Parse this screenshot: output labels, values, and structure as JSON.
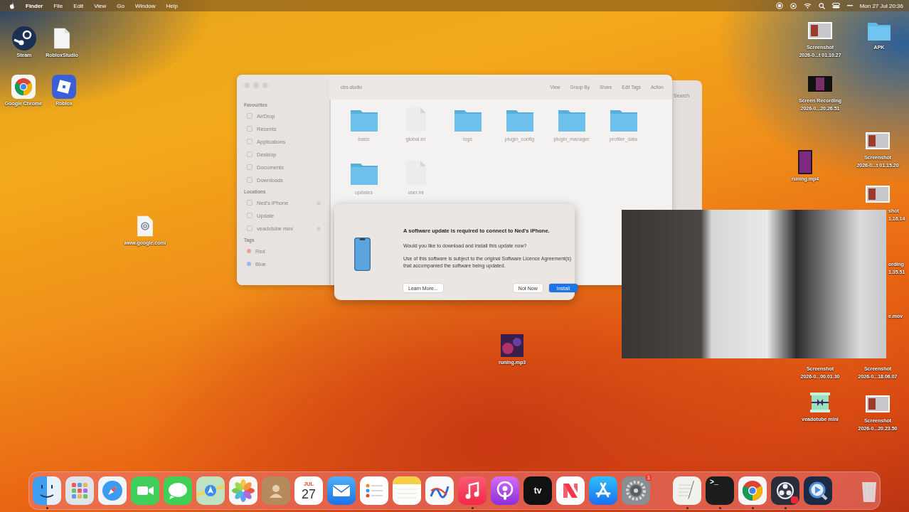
{
  "menu_bar": {
    "app": "Finder",
    "menus": [
      "File",
      "Edit",
      "View",
      "Go",
      "Window",
      "Help"
    ],
    "clock": "Mon 27 Jul  20:36"
  },
  "desktop_icons": [
    {
      "kind": "steam",
      "lines": [
        "Steam"
      ]
    },
    {
      "kind": "document",
      "lines": [
        "RobloxStudio"
      ]
    },
    {
      "kind": "chrome",
      "lines": [
        "Google Chrome"
      ]
    },
    {
      "kind": "roblox",
      "lines": [
        "Roblox"
      ]
    },
    {
      "kind": "webloc",
      "lines": [
        "www.google.com/"
      ]
    },
    {
      "kind": "audio",
      "lines": [
        "runing.mp3"
      ]
    },
    {
      "kind": "thumbnail",
      "lines": [
        "Screenshot",
        "2026-0...t 01.10.27"
      ]
    },
    {
      "kind": "folder",
      "lines": [
        "APK"
      ]
    },
    {
      "kind": "recording",
      "lines": [
        "Screen Recording",
        "2026-0...20.26.51"
      ]
    },
    {
      "kind": "thumbnail",
      "lines": [
        "Screenshot",
        "2026-0...t 01.15.20"
      ]
    },
    {
      "kind": "video",
      "lines": [
        "runing.mp4"
      ]
    },
    {
      "kind": "thumbnail"
    },
    {
      "kind": "partial",
      "lines": [
        "shot",
        "1.16.14"
      ]
    },
    {
      "kind": "partial",
      "lines": [
        "ording",
        "1.35.51"
      ]
    },
    {
      "kind": "partial",
      "lines": [
        "e.mov"
      ]
    },
    {
      "kind": "hidden",
      "lines": [
        "Screenshot",
        "2026-0...00.01.30"
      ]
    },
    {
      "kind": "hidden",
      "lines": [
        "Screenshot",
        "2026-0...18.06.07"
      ]
    },
    {
      "kind": "giftbox",
      "lines": [
        "veadotube mini"
      ]
    },
    {
      "kind": "thumbnail",
      "lines": [
        "Screenshot",
        "2026-0...20.23.50"
      ]
    }
  ],
  "finder": {
    "title": "obs-studio",
    "toolbar": [
      "View",
      "Group By",
      "Share",
      "Edit Tags",
      "Action"
    ],
    "search": "Search",
    "sidebar": [
      {
        "heading": "Favourites",
        "items": [
          {
            "label": "AirDrop"
          },
          {
            "label": "Recents"
          },
          {
            "label": "Applications"
          },
          {
            "label": "Desktop"
          },
          {
            "label": "Documents"
          },
          {
            "label": "Downloads"
          }
        ]
      },
      {
        "heading": "Locations",
        "items": [
          {
            "label": "Ned's iPhone",
            "ejectable": true
          },
          {
            "label": "Update",
            "ejectable": false
          },
          {
            "label": "veadotube mini",
            "ejectable": true
          }
        ]
      },
      {
        "heading": "Tags",
        "items": [
          {
            "label": "Red",
            "color": "#f0a09a"
          },
          {
            "label": "Blue",
            "color": "#9ab8e8"
          }
        ]
      }
    ],
    "files": [
      {
        "name": "basic",
        "kind": "folder"
      },
      {
        "name": "global.ini",
        "kind": "file"
      },
      {
        "name": "logs",
        "kind": "folder"
      },
      {
        "name": "plugin_config",
        "kind": "folder"
      },
      {
        "name": "plugin_manager",
        "kind": "folder"
      },
      {
        "name": "profiler_data",
        "kind": "folder"
      },
      {
        "name": "updates",
        "kind": "folder"
      },
      {
        "name": "user.ini",
        "kind": "file"
      }
    ]
  },
  "dialog": {
    "title": "A software update is required to connect to Ned's iPhone.",
    "message": "Would you like to download and install this update now?",
    "note": "Use of this software is subject to the original Software Licence Agreement(s) that accompanied the software being updated.",
    "buttons": [
      {
        "label": "Learn More...",
        "kind": "help"
      },
      {
        "label": "Not Now",
        "kind": "normal"
      },
      {
        "label": "Install",
        "kind": "default"
      }
    ]
  },
  "dock": {
    "items": [
      {
        "kind": "finder",
        "running": true
      },
      {
        "kind": "launchpad",
        "running": false
      },
      {
        "kind": "safari",
        "running": false
      },
      {
        "kind": "facetime",
        "running": false
      },
      {
        "kind": "messages",
        "running": false
      },
      {
        "kind": "maps",
        "running": false
      },
      {
        "kind": "photos",
        "running": false
      },
      {
        "kind": "contacts",
        "running": false
      },
      {
        "kind": "calendar",
        "running": false,
        "month": "JUL",
        "day": "27"
      },
      {
        "kind": "mail",
        "running": false
      },
      {
        "kind": "reminders",
        "running": false
      },
      {
        "kind": "notes",
        "running": false
      },
      {
        "kind": "freeform",
        "running": false
      },
      {
        "kind": "music",
        "running": true
      },
      {
        "kind": "podcasts",
        "running": false
      },
      {
        "kind": "tv",
        "running": false,
        "text": "tv"
      },
      {
        "kind": "news",
        "running": false
      },
      {
        "kind": "appstore",
        "running": false
      },
      {
        "kind": "settings",
        "running": false,
        "badge": "1"
      },
      {
        "kind": "separator"
      },
      {
        "kind": "textedit",
        "running": true
      },
      {
        "kind": "terminal",
        "running": true,
        "text": ">_"
      },
      {
        "kind": "chrome",
        "running": true
      },
      {
        "kind": "obs",
        "running": true
      },
      {
        "kind": "quicktime",
        "running": false
      },
      {
        "kind": "separator"
      },
      {
        "kind": "trash",
        "running": false
      }
    ]
  }
}
